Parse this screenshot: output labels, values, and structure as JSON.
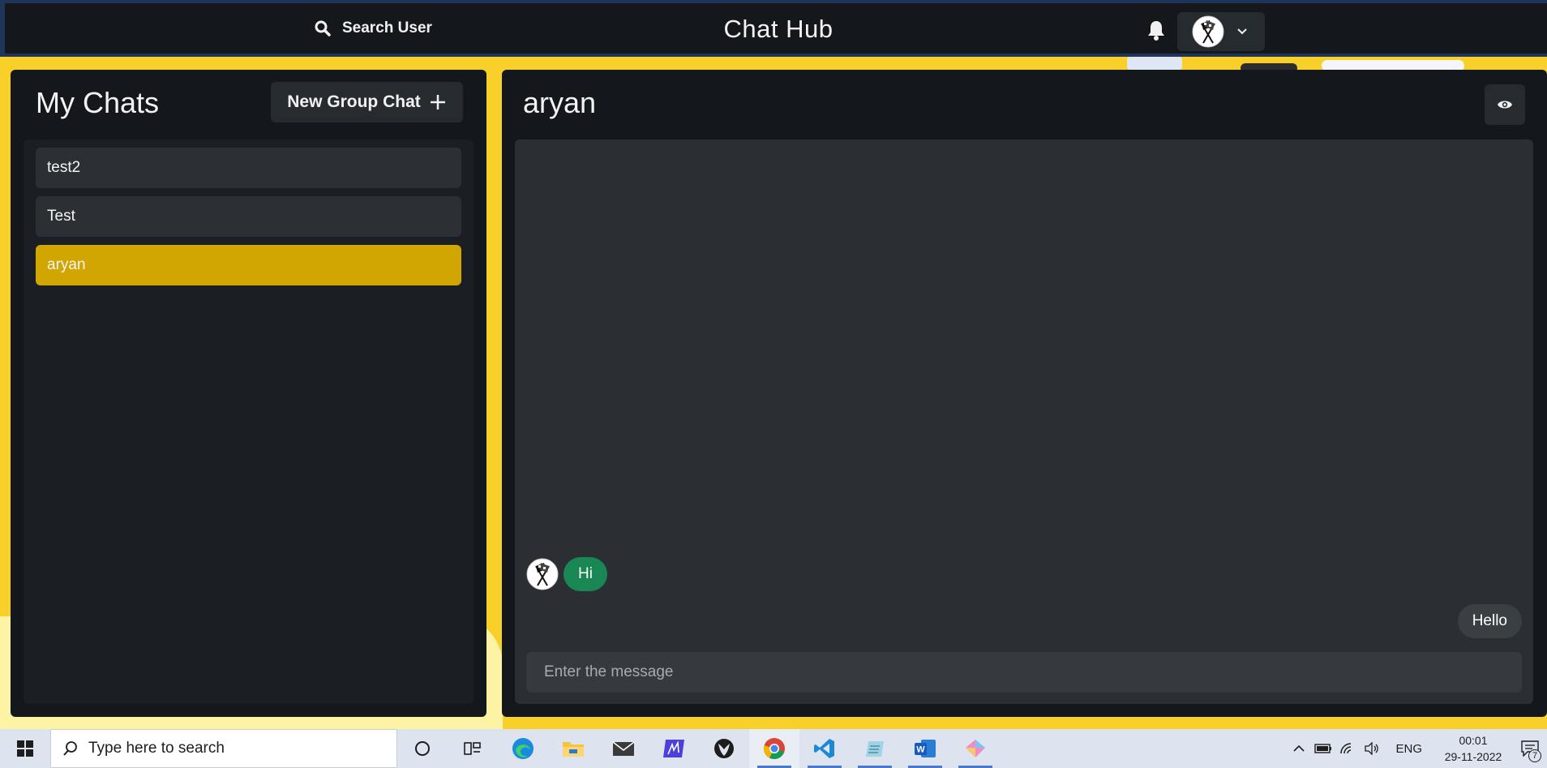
{
  "header": {
    "search_label": "Search User",
    "app_title": "Chat Hub"
  },
  "sidebar": {
    "title": "My Chats",
    "new_group_label": "New Group Chat",
    "chats": [
      {
        "name": "test2",
        "active": false
      },
      {
        "name": "Test",
        "active": false
      },
      {
        "name": "aryan",
        "active": true
      }
    ]
  },
  "chat": {
    "title": "aryan",
    "messages": [
      {
        "text": "Hi",
        "direction": "incoming"
      },
      {
        "text": "Hello",
        "direction": "outgoing"
      }
    ],
    "input_placeholder": "Enter the message"
  },
  "taskbar": {
    "search_placeholder": "Type here to search",
    "apps": [
      "cortana-icon",
      "task-view-icon",
      "edge-icon",
      "file-explorer-icon",
      "mail-icon",
      "sketchbook-icon",
      "xbox-icon",
      "chrome-icon",
      "vscode-icon",
      "notepad-icon",
      "word-icon",
      "drawing-app-icon"
    ],
    "language": "ENG",
    "time": "00:01",
    "date": "29-11-2022",
    "notification_count": "7"
  },
  "colors": {
    "accent": "#d1a502",
    "incoming_bubble": "#198754",
    "background": "#f9cf29",
    "panel": "#14181c"
  }
}
